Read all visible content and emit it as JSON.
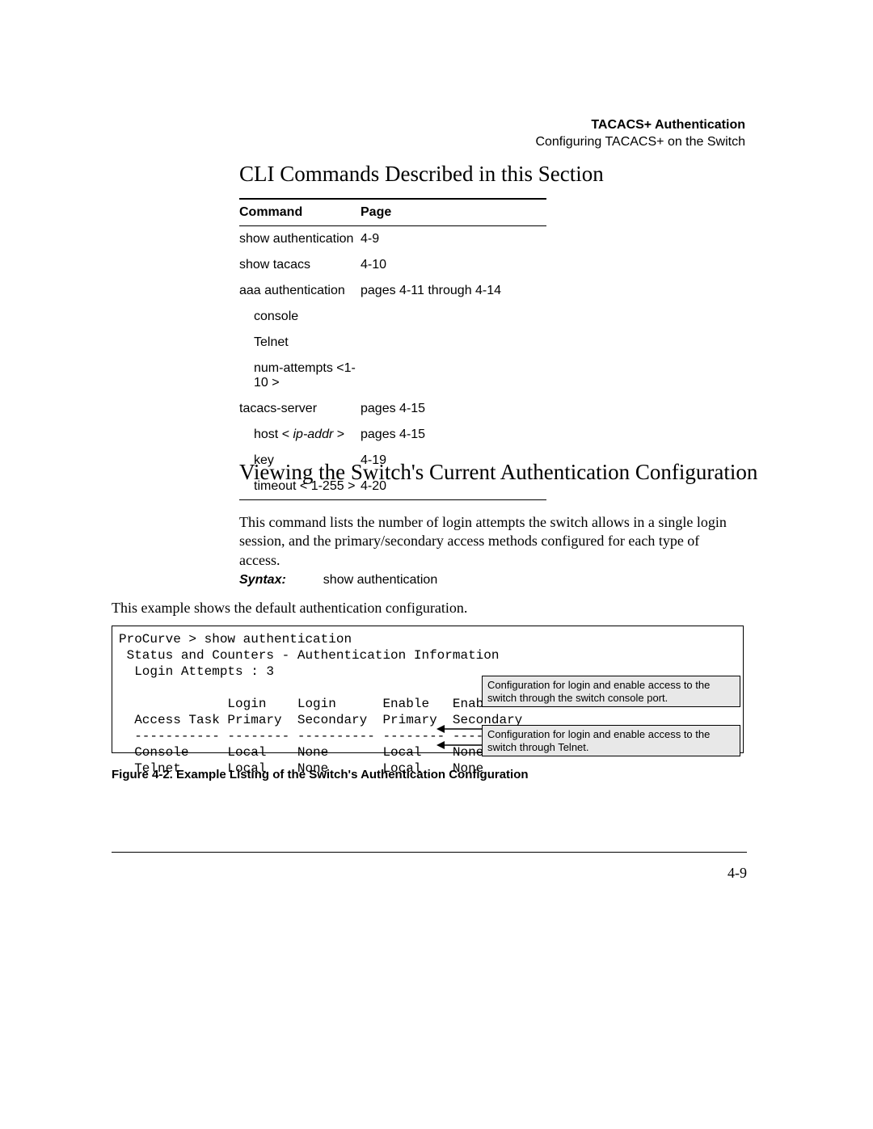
{
  "header": {
    "title": "TACACS+ Authentication",
    "subtitle": "Configuring TACACS+ on the Switch"
  },
  "section_heading": "CLI Commands Described in this Section",
  "table": {
    "headers": {
      "command": "Command",
      "page": "Page"
    },
    "rows": [
      {
        "cmd": "show authentication",
        "indent": 0,
        "page": "4-9"
      },
      {
        "cmd": "show tacacs",
        "indent": 0,
        "page": "4-10"
      },
      {
        "cmd": "aaa authentication",
        "indent": 0,
        "page": "pages 4-11 through 4-14"
      },
      {
        "cmd": "console",
        "indent": 1,
        "page": ""
      },
      {
        "cmd": "Telnet",
        "indent": 1,
        "page": ""
      },
      {
        "cmd": "num-attempts <1-10 >",
        "indent": 1,
        "page": ""
      },
      {
        "cmd": "tacacs-server",
        "indent": 0,
        "page": "pages 4-15"
      },
      {
        "cmd_pre": "host < ",
        "cmd_italic": "ip-addr",
        "cmd_post": " >",
        "indent": 1,
        "page": "pages 4-15"
      },
      {
        "cmd": "key",
        "indent": 1,
        "page": "4-19"
      },
      {
        "cmd": "timeout < 1-255 >",
        "indent": 1,
        "page": "4-20"
      }
    ]
  },
  "heading2": "Viewing the Switch's Current Authentication Configuration",
  "body_para": "This command lists the number of login attempts the switch allows in a single login session, and the primary/secondary access methods configured for each type of access.",
  "syntax": {
    "label": "Syntax:",
    "value": "show authentication"
  },
  "example_para": "This example shows the default authentication configuration.",
  "terminal": "ProCurve > show authentication\n Status and Counters - Authentication Information\n  Login Attempts : 3\n\n              Login    Login      Enable   Enable\n  Access Task Primary  Secondary  Primary  Secondary\n  ----------- -------- ---------- -------- ----------\n  Console     Local    None       Local    None\n  Telnet      Local    None       Local    None",
  "callout1": "Configuration for login and enable access to the switch through the switch console port.",
  "callout2": "Configuration for login and enable access to the switch through Telnet.",
  "figure_caption": "Figure 4-2. Example Listing of the Switch's Authentication Configuration",
  "page_number": "4-9"
}
